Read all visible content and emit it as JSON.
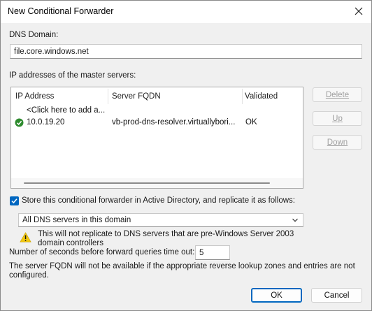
{
  "window": {
    "title": "New Conditional Forwarder"
  },
  "dns_domain": {
    "label": "DNS Domain:",
    "value": "file.core.windows.net"
  },
  "master_servers": {
    "label": "IP addresses of the master servers:",
    "columns": [
      "IP Address",
      "Server FQDN",
      "Validated"
    ],
    "add_row_text": "<Click here to add a...",
    "rows": [
      {
        "ip": "10.0.19.20",
        "fqdn": "vb-prod-dns-resolver.virtuallybori...",
        "validated": "OK",
        "status_icon": "green-check-icon"
      }
    ]
  },
  "side_buttons": {
    "delete": "Delete",
    "up": "Up",
    "down": "Down"
  },
  "replicate": {
    "checked": true,
    "label": "Store this conditional forwarder in Active Directory, and replicate it as follows:",
    "scope_selected": "All DNS servers in this domain",
    "warning_line1": "This will not replicate to DNS servers that are pre-Windows Server 2003",
    "warning_line2": "domain controllers",
    "warning_icon": "warning-triangle-icon"
  },
  "timeout": {
    "label": "Number of seconds before forward queries time out:",
    "value": "5"
  },
  "fqdn_note": {
    "line1": "The server FQDN will not be available if the appropriate reverse lookup zones and entries are not",
    "line2": "configured."
  },
  "buttons": {
    "ok": "OK",
    "cancel": "Cancel"
  },
  "colors": {
    "accent": "#0067c0",
    "warning": "#f2c811",
    "success": "#2e8b2e"
  }
}
